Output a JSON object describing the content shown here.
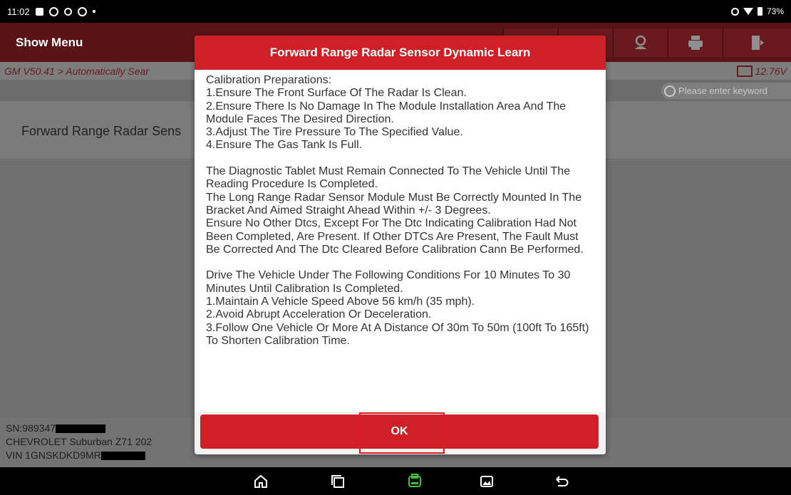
{
  "status_bar": {
    "time": "11:02",
    "battery": "73%"
  },
  "toolbar": {
    "menu_title": "Show Menu"
  },
  "breadcrumb": {
    "path": "GM V50.41 > Automatically Sear",
    "voltage": "12.76V"
  },
  "search": {
    "placeholder": "Please enter keyword"
  },
  "list": {
    "item_label": "Forward Range Radar Sens"
  },
  "vehicle_info": {
    "sn": "SN:989347",
    "model": "CHEVROLET Suburban Z71 202",
    "vin": "VIN 1GNSKDKD9MR"
  },
  "dialog": {
    "title": "Forward Range Radar Sensor Dynamic Learn",
    "body": "Calibration Preparations:\n1.Ensure The Front Surface Of The Radar Is Clean.\n2.Ensure There Is No Damage In The Module Installation Area And The Module Faces The Desired Direction.\n3.Adjust The Tire Pressure To The Specified Value.\n4.Ensure The Gas Tank Is Full.\n\nThe Diagnostic Tablet Must Remain Connected To The Vehicle Until The Reading Procedure Is Completed.\nThe Long Range Radar Sensor Module Must Be Correctly Mounted In The Bracket And Aimed Straight Ahead Within +/- 3 Degrees.\nEnsure No Other Dtcs, Except For The Dtc Indicating Calibration Had Not Been Completed, Are Present. If Other DTCs Are Present, The Fault Must Be Corrected And The Dtc Cleared Before Calibration Cann Be Performed.\n\nDrive The Vehicle Under The Following Conditions For 10 Minutes To 30 Minutes Until Calibration Is Completed.\n1.Maintain A Vehicle Speed Above 56 km/h (35 mph).\n2.Avoid Abrupt Acceleration Or Deceleration.\n3.Follow One Vehicle Or More At A Distance Of 30m To 50m (100ft To 165ft) To Shorten Calibration Time.",
    "ok_label": "OK"
  },
  "colors": {
    "accent": "#cf1f27",
    "toolbar": "#5a1418",
    "overlay": "#7a7a7a"
  },
  "icons": {
    "status_left": [
      "image-icon",
      "gear-icon",
      "usb-icon",
      "bluetooth-icon",
      "dot-icon"
    ],
    "status_right": [
      "vibrate-icon",
      "wifi-icon",
      "battery-icon"
    ],
    "toolbar": [
      "feedback-icon",
      "print-icon",
      "exit-icon"
    ],
    "nav": [
      "home-icon",
      "recents-icon",
      "vci-icon",
      "gallery-icon",
      "back-icon"
    ]
  }
}
